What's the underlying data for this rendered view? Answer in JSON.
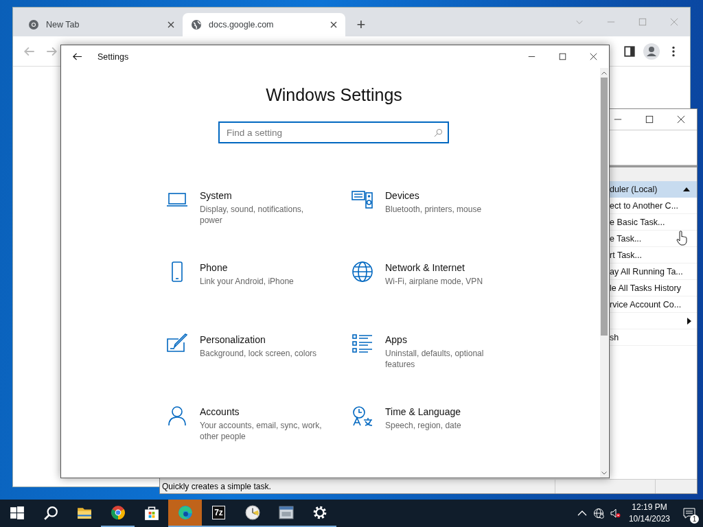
{
  "browser": {
    "tabs": [
      {
        "label": "New Tab",
        "kind": "chrome",
        "selected": false
      },
      {
        "label": "docs.google.com",
        "kind": "web",
        "selected": true
      }
    ],
    "new_tab": "+"
  },
  "scheduler": {
    "actions_header": "duler (Local)",
    "actions": [
      {
        "kind": "item",
        "label": "ect to Another C..."
      },
      {
        "kind": "item",
        "label": "e Basic Task..."
      },
      {
        "kind": "item",
        "label": "e Task..."
      },
      {
        "kind": "item",
        "label": "rt Task..."
      },
      {
        "kind": "item",
        "label": "ay All Running Ta..."
      },
      {
        "kind": "item",
        "label": "le All Tasks History"
      },
      {
        "kind": "item",
        "label": "rvice Account Co..."
      },
      {
        "kind": "submenu"
      },
      {
        "kind": "item",
        "label": "sh"
      }
    ],
    "status": "Quickly creates a simple task."
  },
  "settings": {
    "title": "Settings",
    "heading": "Windows Settings",
    "search": {
      "placeholder": "Find a setting"
    },
    "categories": [
      {
        "kind": "system",
        "name": "System",
        "description": "Display, sound, notifications, power"
      },
      {
        "kind": "devices",
        "name": "Devices",
        "description": "Bluetooth, printers, mouse"
      },
      {
        "kind": "phone",
        "name": "Phone",
        "description": "Link your Android, iPhone"
      },
      {
        "kind": "network",
        "name": "Network & Internet",
        "description": "Wi-Fi, airplane mode, VPN"
      },
      {
        "kind": "personalization",
        "name": "Personalization",
        "description": "Background, lock screen, colors"
      },
      {
        "kind": "apps",
        "name": "Apps",
        "description": "Uninstall, defaults, optional features"
      },
      {
        "kind": "accounts",
        "name": "Accounts",
        "description": "Your accounts, email, sync, work, other people"
      },
      {
        "kind": "time",
        "name": "Time & Language",
        "description": "Speech, region, date"
      }
    ]
  },
  "taskbar": {
    "apps": [
      {
        "kind": "start",
        "running": false,
        "selected": false
      },
      {
        "kind": "search",
        "running": false,
        "selected": false
      },
      {
        "kind": "folder",
        "running": false,
        "selected": false
      },
      {
        "kind": "chrome",
        "running": true,
        "selected": false
      },
      {
        "kind": "store",
        "running": false,
        "selected": false
      },
      {
        "kind": "edge",
        "running": true,
        "selected": true
      },
      {
        "kind": "sevenzip",
        "label": "7z",
        "running": true,
        "selected": false
      },
      {
        "kind": "clock",
        "running": true,
        "selected": false
      },
      {
        "kind": "window",
        "running": true,
        "selected": false
      },
      {
        "kind": "gear",
        "running": true,
        "selected": false
      }
    ],
    "time": "12:19 PM",
    "date": "10/14/2023",
    "notifications": "1"
  }
}
